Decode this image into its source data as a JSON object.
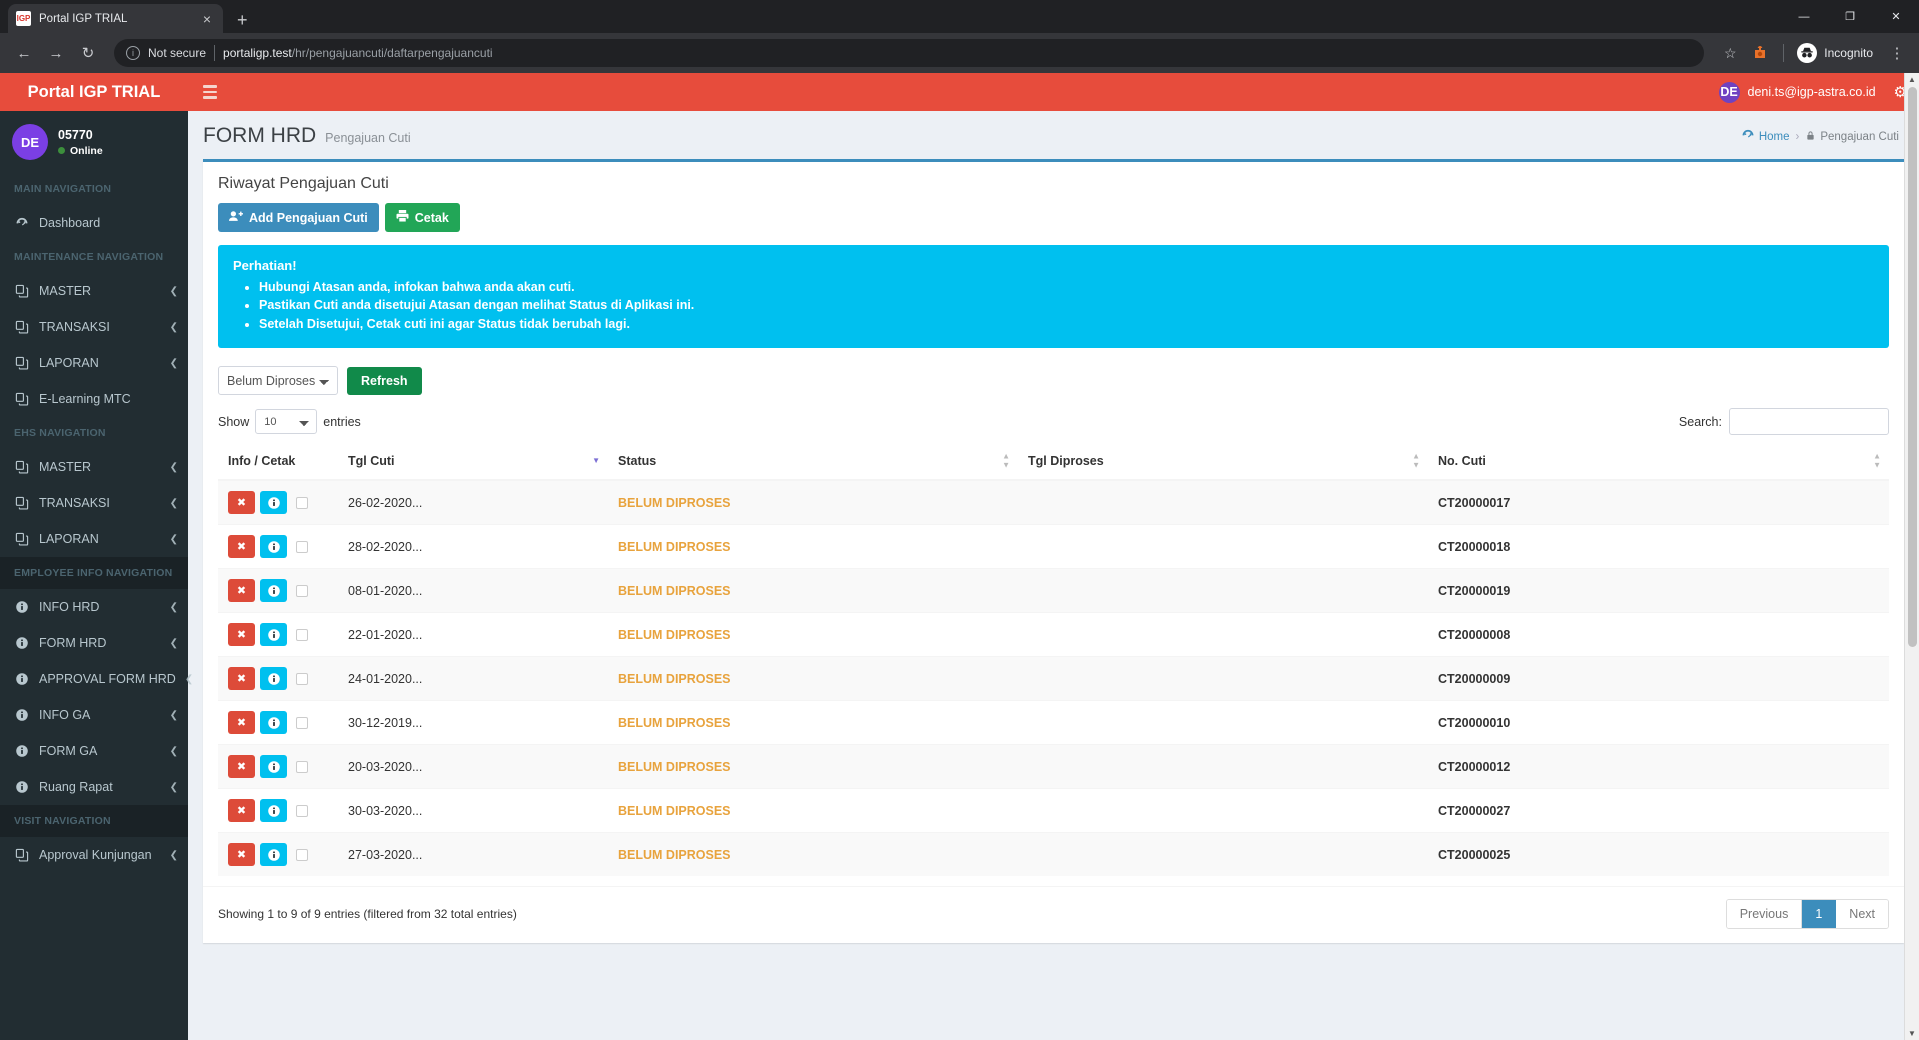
{
  "browser": {
    "tab_title": "Portal IGP TRIAL",
    "favicon_text": "IGP",
    "close_glyph": "×",
    "newtab_glyph": "+",
    "window_minimize": "—",
    "window_maximize": "❐",
    "window_close": "✕",
    "back_glyph": "←",
    "forward_glyph": "→",
    "reload_glyph": "↻",
    "security_label": "Not secure",
    "info_glyph": "i",
    "url_domain": "portaligp.test",
    "url_path": "/hr/pengajuancuti/daftarpengajuancuti",
    "star_glyph": "☆",
    "profile_label": "Incognito",
    "menu_glyph": "⋮"
  },
  "sidebar": {
    "brand": "Portal IGP TRIAL",
    "user": {
      "initials": "DE",
      "name": "05770",
      "status": "Online"
    },
    "sections": [
      {
        "header": "MAIN NAVIGATION",
        "highlight": false,
        "items": [
          {
            "label": "Dashboard",
            "icon": "dashboard-icon",
            "caret": false
          }
        ]
      },
      {
        "header": "MAINTENANCE NAVIGATION",
        "highlight": false,
        "items": [
          {
            "label": "MASTER",
            "icon": "copy-icon",
            "caret": true
          },
          {
            "label": "TRANSAKSI",
            "icon": "copy-icon",
            "caret": true
          },
          {
            "label": "LAPORAN",
            "icon": "copy-icon",
            "caret": true
          },
          {
            "label": "E-Learning MTC",
            "icon": "copy-icon",
            "caret": false
          }
        ]
      },
      {
        "header": "EHS NAVIGATION",
        "highlight": false,
        "items": [
          {
            "label": "MASTER",
            "icon": "copy-icon",
            "caret": true
          },
          {
            "label": "TRANSAKSI",
            "icon": "copy-icon",
            "caret": true
          },
          {
            "label": "LAPORAN",
            "icon": "copy-icon",
            "caret": true
          }
        ]
      },
      {
        "header": "EMPLOYEE INFO NAVIGATION",
        "highlight": true,
        "items": [
          {
            "label": "INFO HRD",
            "icon": "info-icon",
            "caret": true
          },
          {
            "label": "FORM HRD",
            "icon": "info-icon",
            "caret": true
          },
          {
            "label": "APPROVAL FORM HRD",
            "icon": "info-icon",
            "caret": true
          },
          {
            "label": "INFO GA",
            "icon": "info-icon",
            "caret": true
          },
          {
            "label": "FORM GA",
            "icon": "info-icon",
            "caret": true
          },
          {
            "label": "Ruang Rapat",
            "icon": "info-icon",
            "caret": true
          }
        ]
      },
      {
        "header": "VISIT NAVIGATION",
        "highlight": true,
        "items": [
          {
            "label": "Approval Kunjungan",
            "icon": "copy-icon",
            "caret": true
          }
        ]
      }
    ]
  },
  "navbar": {
    "user_initials": "DE",
    "user_email": "deni.ts@igp-astra.co.id",
    "gear_glyph": "⚙"
  },
  "page": {
    "title": "FORM HRD",
    "subtitle": "Pengajuan Cuti",
    "breadcrumb": [
      {
        "label": "Home",
        "icon": "dashboard-icon",
        "current": false
      },
      {
        "label": "Pengajuan Cuti",
        "icon": "lock-icon",
        "current": true
      }
    ],
    "separator": "›"
  },
  "box": {
    "title": "Riwayat Pengajuan Cuti",
    "buttons": [
      {
        "label": "Add Pengajuan Cuti",
        "style": "primary",
        "icon": "user-plus-icon"
      },
      {
        "label": "Cetak",
        "style": "success",
        "icon": "print-icon"
      }
    ],
    "alert": {
      "heading": "Perhatian!",
      "items": [
        "Hubungi Atasan anda, infokan bahwa anda akan cuti.",
        "Pastikan Cuti anda disetujui Atasan dengan melihat Status di Aplikasi ini.",
        "Setelah Disetujui, Cetak cuti ini agar Status tidak berubah lagi."
      ],
      "color": "#00c0ef"
    },
    "filter": {
      "selected": "Belum Diproses",
      "refresh_label": "Refresh"
    },
    "show_label": "Show",
    "entries_label": "entries",
    "page_length": "10",
    "search_label": "Search:",
    "search_value": ""
  },
  "table": {
    "columns": [
      {
        "label": "Info / Cetak",
        "sortable": false,
        "sorted": false
      },
      {
        "label": "Tgl Cuti",
        "sortable": true,
        "sorted": true
      },
      {
        "label": "Status",
        "sortable": true,
        "sorted": false
      },
      {
        "label": "Tgl Diproses",
        "sortable": true,
        "sorted": false
      },
      {
        "label": "No. Cuti",
        "sortable": true,
        "sorted": false
      }
    ],
    "delete_glyph": "✖",
    "info_glyph": "i",
    "rows": [
      {
        "tgl_cuti": "26-02-2020...",
        "status": "BELUM DIPROSES",
        "tgl_diproses": "",
        "no_cuti": "CT20000017"
      },
      {
        "tgl_cuti": "28-02-2020...",
        "status": "BELUM DIPROSES",
        "tgl_diproses": "",
        "no_cuti": "CT20000018"
      },
      {
        "tgl_cuti": "08-01-2020...",
        "status": "BELUM DIPROSES",
        "tgl_diproses": "",
        "no_cuti": "CT20000019"
      },
      {
        "tgl_cuti": "22-01-2020...",
        "status": "BELUM DIPROSES",
        "tgl_diproses": "",
        "no_cuti": "CT20000008"
      },
      {
        "tgl_cuti": "24-01-2020...",
        "status": "BELUM DIPROSES",
        "tgl_diproses": "",
        "no_cuti": "CT20000009"
      },
      {
        "tgl_cuti": "30-12-2019...",
        "status": "BELUM DIPROSES",
        "tgl_diproses": "",
        "no_cuti": "CT20000010"
      },
      {
        "tgl_cuti": "20-03-2020...",
        "status": "BELUM DIPROSES",
        "tgl_diproses": "",
        "no_cuti": "CT20000012"
      },
      {
        "tgl_cuti": "30-03-2020...",
        "status": "BELUM DIPROSES",
        "tgl_diproses": "",
        "no_cuti": "CT20000027"
      },
      {
        "tgl_cuti": "27-03-2020...",
        "status": "BELUM DIPROSES",
        "tgl_diproses": "",
        "no_cuti": "CT20000025"
      }
    ],
    "footer_info": "Showing 1 to 9 of 9 entries (filtered from 32 total entries)",
    "pagination": [
      {
        "label": "Previous",
        "active": false
      },
      {
        "label": "1",
        "active": true
      },
      {
        "label": "Next",
        "active": false
      }
    ]
  }
}
